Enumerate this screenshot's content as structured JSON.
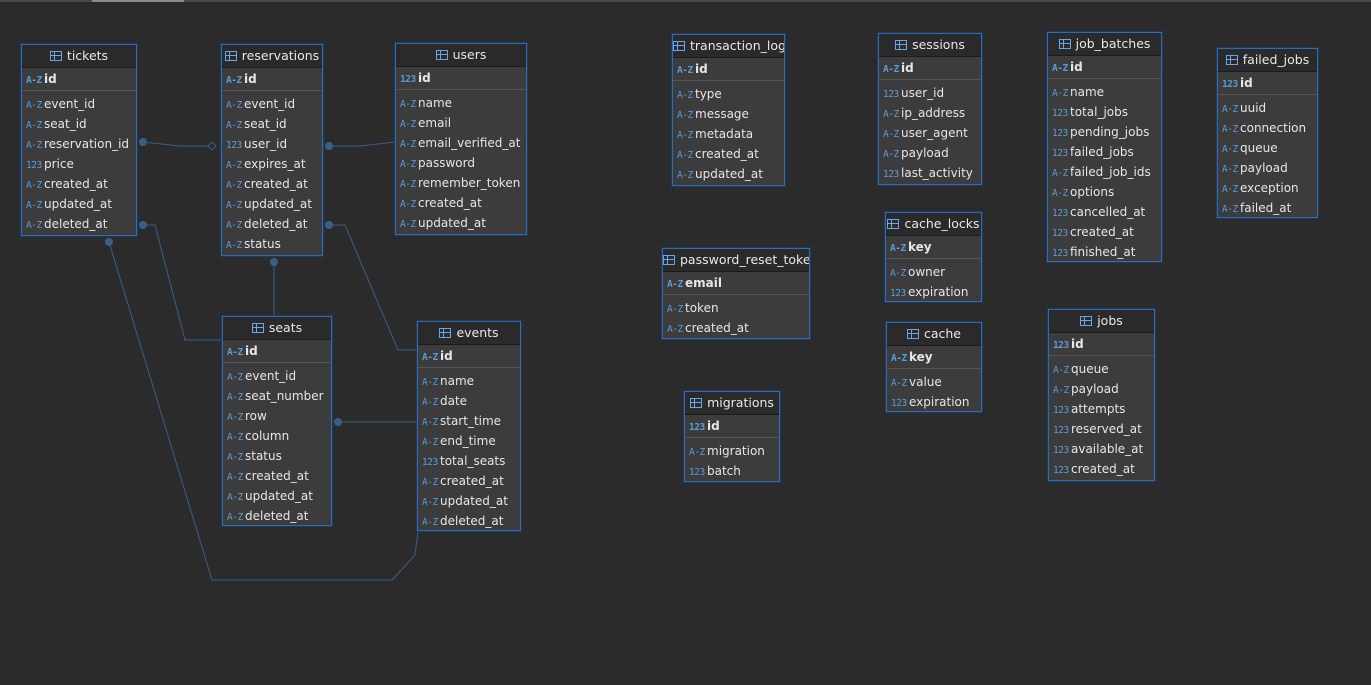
{
  "colors": {
    "background": "#2b2b2b",
    "entity_border": "#2f6bb3",
    "entity_body": "#3c3c3c",
    "line": "#3a5f86",
    "type_icon": "#5b9bd8"
  },
  "icons": {
    "table": "table-icon",
    "string_type": "A-Z",
    "number_type": "123"
  },
  "entities": [
    {
      "name": "tickets",
      "pk": {
        "type": "A-Z",
        "name": "id"
      },
      "columns": [
        {
          "type": "A-Z",
          "name": "event_id"
        },
        {
          "type": "A-Z",
          "name": "seat_id"
        },
        {
          "type": "A-Z",
          "name": "reservation_id"
        },
        {
          "type": "123",
          "name": "price"
        },
        {
          "type": "A-Z",
          "name": "created_at"
        },
        {
          "type": "A-Z",
          "name": "updated_at"
        },
        {
          "type": "A-Z",
          "name": "deleted_at"
        }
      ]
    },
    {
      "name": "reservations",
      "pk": {
        "type": "A-Z",
        "name": "id"
      },
      "columns": [
        {
          "type": "A-Z",
          "name": "event_id"
        },
        {
          "type": "A-Z",
          "name": "seat_id"
        },
        {
          "type": "123",
          "name": "user_id"
        },
        {
          "type": "A-Z",
          "name": "expires_at"
        },
        {
          "type": "A-Z",
          "name": "created_at"
        },
        {
          "type": "A-Z",
          "name": "updated_at"
        },
        {
          "type": "A-Z",
          "name": "deleted_at"
        },
        {
          "type": "A-Z",
          "name": "status"
        }
      ]
    },
    {
      "name": "users",
      "pk": {
        "type": "123",
        "name": "id"
      },
      "columns": [
        {
          "type": "A-Z",
          "name": "name"
        },
        {
          "type": "A-Z",
          "name": "email"
        },
        {
          "type": "A-Z",
          "name": "email_verified_at"
        },
        {
          "type": "A-Z",
          "name": "password"
        },
        {
          "type": "A-Z",
          "name": "remember_token"
        },
        {
          "type": "A-Z",
          "name": "created_at"
        },
        {
          "type": "A-Z",
          "name": "updated_at"
        }
      ]
    },
    {
      "name": "seats",
      "pk": {
        "type": "A-Z",
        "name": "id"
      },
      "columns": [
        {
          "type": "A-Z",
          "name": "event_id"
        },
        {
          "type": "A-Z",
          "name": "seat_number"
        },
        {
          "type": "A-Z",
          "name": "row"
        },
        {
          "type": "A-Z",
          "name": "column"
        },
        {
          "type": "A-Z",
          "name": "status"
        },
        {
          "type": "A-Z",
          "name": "created_at"
        },
        {
          "type": "A-Z",
          "name": "updated_at"
        },
        {
          "type": "A-Z",
          "name": "deleted_at"
        }
      ]
    },
    {
      "name": "events",
      "pk": {
        "type": "A-Z",
        "name": "id"
      },
      "columns": [
        {
          "type": "A-Z",
          "name": "name"
        },
        {
          "type": "A-Z",
          "name": "date"
        },
        {
          "type": "A-Z",
          "name": "start_time"
        },
        {
          "type": "A-Z",
          "name": "end_time"
        },
        {
          "type": "123",
          "name": "total_seats"
        },
        {
          "type": "A-Z",
          "name": "created_at"
        },
        {
          "type": "A-Z",
          "name": "updated_at"
        },
        {
          "type": "A-Z",
          "name": "deleted_at"
        }
      ]
    },
    {
      "name": "transaction_logs",
      "pk": {
        "type": "A-Z",
        "name": "id"
      },
      "columns": [
        {
          "type": "A-Z",
          "name": "type"
        },
        {
          "type": "A-Z",
          "name": "message"
        },
        {
          "type": "A-Z",
          "name": "metadata"
        },
        {
          "type": "A-Z",
          "name": "created_at"
        },
        {
          "type": "A-Z",
          "name": "updated_at"
        }
      ]
    },
    {
      "name": "password_reset_tokens",
      "pk": {
        "type": "A-Z",
        "name": "email"
      },
      "columns": [
        {
          "type": "A-Z",
          "name": "token"
        },
        {
          "type": "A-Z",
          "name": "created_at"
        }
      ]
    },
    {
      "name": "migrations",
      "pk": {
        "type": "123",
        "name": "id"
      },
      "columns": [
        {
          "type": "A-Z",
          "name": "migration"
        },
        {
          "type": "123",
          "name": "batch"
        }
      ]
    },
    {
      "name": "sessions",
      "pk": {
        "type": "A-Z",
        "name": "id"
      },
      "columns": [
        {
          "type": "123",
          "name": "user_id"
        },
        {
          "type": "A-Z",
          "name": "ip_address"
        },
        {
          "type": "A-Z",
          "name": "user_agent"
        },
        {
          "type": "A-Z",
          "name": "payload"
        },
        {
          "type": "123",
          "name": "last_activity"
        }
      ]
    },
    {
      "name": "cache_locks",
      "pk": {
        "type": "A-Z",
        "name": "key"
      },
      "columns": [
        {
          "type": "A-Z",
          "name": "owner"
        },
        {
          "type": "123",
          "name": "expiration"
        }
      ]
    },
    {
      "name": "cache",
      "pk": {
        "type": "A-Z",
        "name": "key"
      },
      "columns": [
        {
          "type": "A-Z",
          "name": "value"
        },
        {
          "type": "123",
          "name": "expiration"
        }
      ]
    },
    {
      "name": "job_batches",
      "pk": {
        "type": "A-Z",
        "name": "id"
      },
      "columns": [
        {
          "type": "A-Z",
          "name": "name"
        },
        {
          "type": "123",
          "name": "total_jobs"
        },
        {
          "type": "123",
          "name": "pending_jobs"
        },
        {
          "type": "123",
          "name": "failed_jobs"
        },
        {
          "type": "A-Z",
          "name": "failed_job_ids"
        },
        {
          "type": "A-Z",
          "name": "options"
        },
        {
          "type": "123",
          "name": "cancelled_at"
        },
        {
          "type": "123",
          "name": "created_at"
        },
        {
          "type": "123",
          "name": "finished_at"
        }
      ]
    },
    {
      "name": "jobs",
      "pk": {
        "type": "123",
        "name": "id"
      },
      "columns": [
        {
          "type": "A-Z",
          "name": "queue"
        },
        {
          "type": "A-Z",
          "name": "payload"
        },
        {
          "type": "123",
          "name": "attempts"
        },
        {
          "type": "123",
          "name": "reserved_at"
        },
        {
          "type": "123",
          "name": "available_at"
        },
        {
          "type": "123",
          "name": "created_at"
        }
      ]
    },
    {
      "name": "failed_jobs",
      "pk": {
        "type": "123",
        "name": "id"
      },
      "columns": [
        {
          "type": "A-Z",
          "name": "uuid"
        },
        {
          "type": "A-Z",
          "name": "connection"
        },
        {
          "type": "A-Z",
          "name": "queue"
        },
        {
          "type": "A-Z",
          "name": "payload"
        },
        {
          "type": "A-Z",
          "name": "exception"
        },
        {
          "type": "A-Z",
          "name": "failed_at"
        }
      ]
    }
  ]
}
